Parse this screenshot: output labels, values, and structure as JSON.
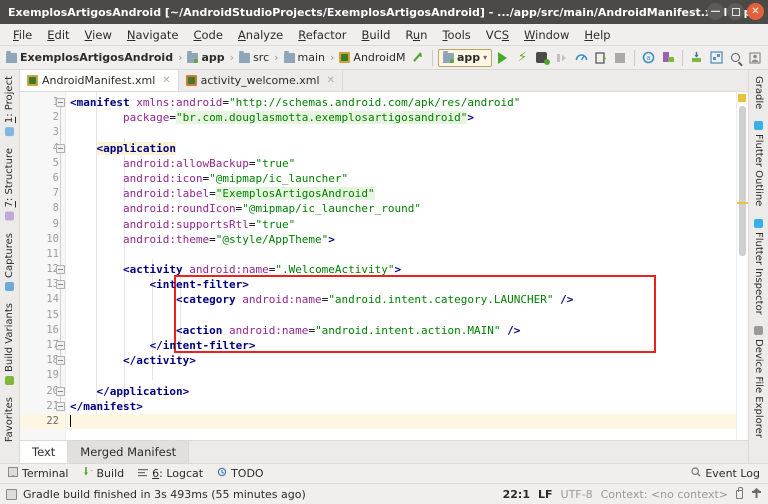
{
  "window": {
    "title": "ExemplosArtigosAndroid [~/AndroidStudioProjects/ExemplosArtigosAndroid] - .../app/src/main/AndroidManifest.xml [ap...",
    "minimize_label": "—",
    "maximize_label": "▫",
    "close_label": "✕"
  },
  "menubar": {
    "items": [
      {
        "pre": "",
        "mn": "F",
        "post": "ile"
      },
      {
        "pre": "",
        "mn": "E",
        "post": "dit"
      },
      {
        "pre": "",
        "mn": "V",
        "post": "iew"
      },
      {
        "pre": "",
        "mn": "N",
        "post": "avigate"
      },
      {
        "pre": "",
        "mn": "C",
        "post": "ode"
      },
      {
        "pre": "",
        "mn": "A",
        "post": "nalyze"
      },
      {
        "pre": "",
        "mn": "R",
        "post": "efactor"
      },
      {
        "pre": "",
        "mn": "B",
        "post": "uild"
      },
      {
        "pre": "R",
        "mn": "u",
        "post": "n"
      },
      {
        "pre": "",
        "mn": "T",
        "post": "ools"
      },
      {
        "pre": "VC",
        "mn": "S",
        "post": ""
      },
      {
        "pre": "",
        "mn": "W",
        "post": "indow"
      },
      {
        "pre": "",
        "mn": "H",
        "post": "elp"
      }
    ]
  },
  "navbar": {
    "breadcrumb": [
      "ExemplosArtigosAndroid",
      "app",
      "src",
      "main",
      "AndroidM"
    ],
    "separator": "›",
    "run_config": "app",
    "dropdown_caret": "▾"
  },
  "tabs": [
    {
      "label": "AndroidManifest.xml",
      "close": "✕",
      "active": true
    },
    {
      "label": "activity_welcome.xml",
      "close": "✕",
      "active": false
    }
  ],
  "editor": {
    "line_numbers": [
      "1",
      "2",
      "3",
      "4",
      "5",
      "6",
      "7",
      "8",
      "9",
      "10",
      "11",
      "12",
      "13",
      "14",
      "15",
      "16",
      "17",
      "18",
      "19",
      "20",
      "21",
      "22"
    ],
    "current_line": 22,
    "lines": [
      {
        "n": 1,
        "tokens": [
          {
            "t": "<manifest ",
            "c": "tagn"
          },
          {
            "t": "xmlns:android",
            "c": "attr"
          },
          {
            "t": "=",
            "c": "eq"
          },
          {
            "t": "\"http://schemas.android.com/apk/res/android\"",
            "c": "str"
          }
        ]
      },
      {
        "n": 2,
        "tokens": [
          {
            "t": "        ",
            "c": "plain"
          },
          {
            "t": "package",
            "c": "attr"
          },
          {
            "t": "=",
            "c": "eq"
          },
          {
            "t": "\"br.com.douglasmotta.exemplosartigosandroid\"",
            "c": "strhl"
          },
          {
            "t": ">",
            "c": "tagn"
          }
        ]
      },
      {
        "n": 3,
        "tokens": []
      },
      {
        "n": 4,
        "tokens": [
          {
            "t": "    ",
            "c": "plain"
          },
          {
            "t": "<application",
            "c": "tagn hlbg"
          }
        ]
      },
      {
        "n": 5,
        "tokens": [
          {
            "t": "        ",
            "c": "plain"
          },
          {
            "t": "android:allowBackup",
            "c": "attr"
          },
          {
            "t": "=",
            "c": "eq"
          },
          {
            "t": "\"true\"",
            "c": "str"
          }
        ]
      },
      {
        "n": 6,
        "tokens": [
          {
            "t": "        ",
            "c": "plain"
          },
          {
            "t": "android:icon",
            "c": "attr"
          },
          {
            "t": "=",
            "c": "eq"
          },
          {
            "t": "\"@mipmap/ic_launcher\"",
            "c": "str"
          }
        ]
      },
      {
        "n": 7,
        "tokens": [
          {
            "t": "        ",
            "c": "plain"
          },
          {
            "t": "android:label",
            "c": "attr"
          },
          {
            "t": "=",
            "c": "eq"
          },
          {
            "t": "\"ExemplosArtigosAndroid\"",
            "c": "strhl"
          }
        ]
      },
      {
        "n": 8,
        "tokens": [
          {
            "t": "        ",
            "c": "plain"
          },
          {
            "t": "android:roundIcon",
            "c": "attr"
          },
          {
            "t": "=",
            "c": "eq"
          },
          {
            "t": "\"@mipmap/ic_launcher_round\"",
            "c": "str"
          }
        ]
      },
      {
        "n": 9,
        "tokens": [
          {
            "t": "        ",
            "c": "plain"
          },
          {
            "t": "android:supportsRtl",
            "c": "attr"
          },
          {
            "t": "=",
            "c": "eq"
          },
          {
            "t": "\"true\"",
            "c": "str"
          }
        ]
      },
      {
        "n": 10,
        "tokens": [
          {
            "t": "        ",
            "c": "plain"
          },
          {
            "t": "android:theme",
            "c": "attr"
          },
          {
            "t": "=",
            "c": "eq"
          },
          {
            "t": "\"@style/AppTheme\"",
            "c": "str"
          },
          {
            "t": ">",
            "c": "tagn"
          }
        ]
      },
      {
        "n": 11,
        "tokens": []
      },
      {
        "n": 12,
        "tokens": [
          {
            "t": "        ",
            "c": "plain"
          },
          {
            "t": "<activity ",
            "c": "tagn"
          },
          {
            "t": "android:name",
            "c": "attr"
          },
          {
            "t": "=",
            "c": "eq"
          },
          {
            "t": "\".WelcomeActivity\"",
            "c": "str"
          },
          {
            "t": ">",
            "c": "tagn"
          }
        ]
      },
      {
        "n": 13,
        "tokens": [
          {
            "t": "            ",
            "c": "plain"
          },
          {
            "t": "<intent-filter>",
            "c": "tagn"
          }
        ]
      },
      {
        "n": 14,
        "tokens": [
          {
            "t": "                ",
            "c": "plain"
          },
          {
            "t": "<category ",
            "c": "tagn"
          },
          {
            "t": "android:name",
            "c": "attr"
          },
          {
            "t": "=",
            "c": "eq"
          },
          {
            "t": "\"android.intent.category.LAUNCHER\"",
            "c": "str"
          },
          {
            "t": " />",
            "c": "tagn"
          }
        ]
      },
      {
        "n": 15,
        "tokens": []
      },
      {
        "n": 16,
        "tokens": [
          {
            "t": "                ",
            "c": "plain"
          },
          {
            "t": "<action ",
            "c": "tagn"
          },
          {
            "t": "android:name",
            "c": "attr"
          },
          {
            "t": "=",
            "c": "eq"
          },
          {
            "t": "\"android.intent.action.MAIN\"",
            "c": "str"
          },
          {
            "t": " />",
            "c": "tagn"
          }
        ]
      },
      {
        "n": 17,
        "tokens": [
          {
            "t": "            ",
            "c": "plain"
          },
          {
            "t": "</intent-filter>",
            "c": "tagn"
          }
        ]
      },
      {
        "n": 18,
        "tokens": [
          {
            "t": "        ",
            "c": "plain"
          },
          {
            "t": "</activity>",
            "c": "tagn"
          }
        ]
      },
      {
        "n": 19,
        "tokens": []
      },
      {
        "n": 20,
        "tokens": [
          {
            "t": "    ",
            "c": "plain"
          },
          {
            "t": "</application>",
            "c": "tagn"
          }
        ]
      },
      {
        "n": 21,
        "tokens": [
          {
            "t": "</manifest>",
            "c": "tagn"
          }
        ]
      },
      {
        "n": 22,
        "tokens": []
      }
    ],
    "annotation_color": "#e8231c"
  },
  "left_strip": [
    {
      "label": "1: Project",
      "pre": "",
      "mn": "1",
      "post": ": Project",
      "dot": "#7fb8e0"
    },
    {
      "label": "7: Structure",
      "pre": "",
      "mn": "7",
      "post": ": Structure",
      "dot": "#c0a8d8"
    },
    {
      "label": "Captures",
      "pre": "Captures",
      "mn": "",
      "post": "",
      "dot": "#6aa9d8"
    },
    {
      "label": "Build Variants",
      "pre": "Build Variants",
      "mn": "",
      "post": "",
      "dot": "#7fb83c"
    },
    {
      "label": "Favorites",
      "pre": "Favorites",
      "mn": "",
      "post": "",
      "dot": ""
    }
  ],
  "right_strip": [
    {
      "label": "Gradle",
      "dot": ""
    },
    {
      "label": "Flutter Outline",
      "dot": "#35b0e8"
    },
    {
      "label": "Flutter Inspector",
      "dot": "#35b0e8"
    },
    {
      "label": "Device File Explorer",
      "dot": "#9a9a9a"
    }
  ],
  "subtabs": [
    {
      "label": "Text",
      "active": true
    },
    {
      "label": "Merged Manifest",
      "active": false
    }
  ],
  "toolwindows": {
    "items": [
      {
        "pre": "Terminal",
        "mn": "",
        "post": ""
      },
      {
        "pre": "Build",
        "mn": "",
        "post": ""
      },
      {
        "pre": "",
        "mn": "6",
        "post": ": Logcat"
      },
      {
        "pre": "TODO",
        "mn": "",
        "post": ""
      }
    ],
    "event_log": "Event Log"
  },
  "statusbar": {
    "message": "Gradle build finished in 3s 493ms (55 minutes ago)",
    "caret": "22:1",
    "line_sep": "LF⁣",
    "line_sep_caret": "⋮",
    "encoding": "UTF-8",
    "context": "Context: <no context>"
  }
}
